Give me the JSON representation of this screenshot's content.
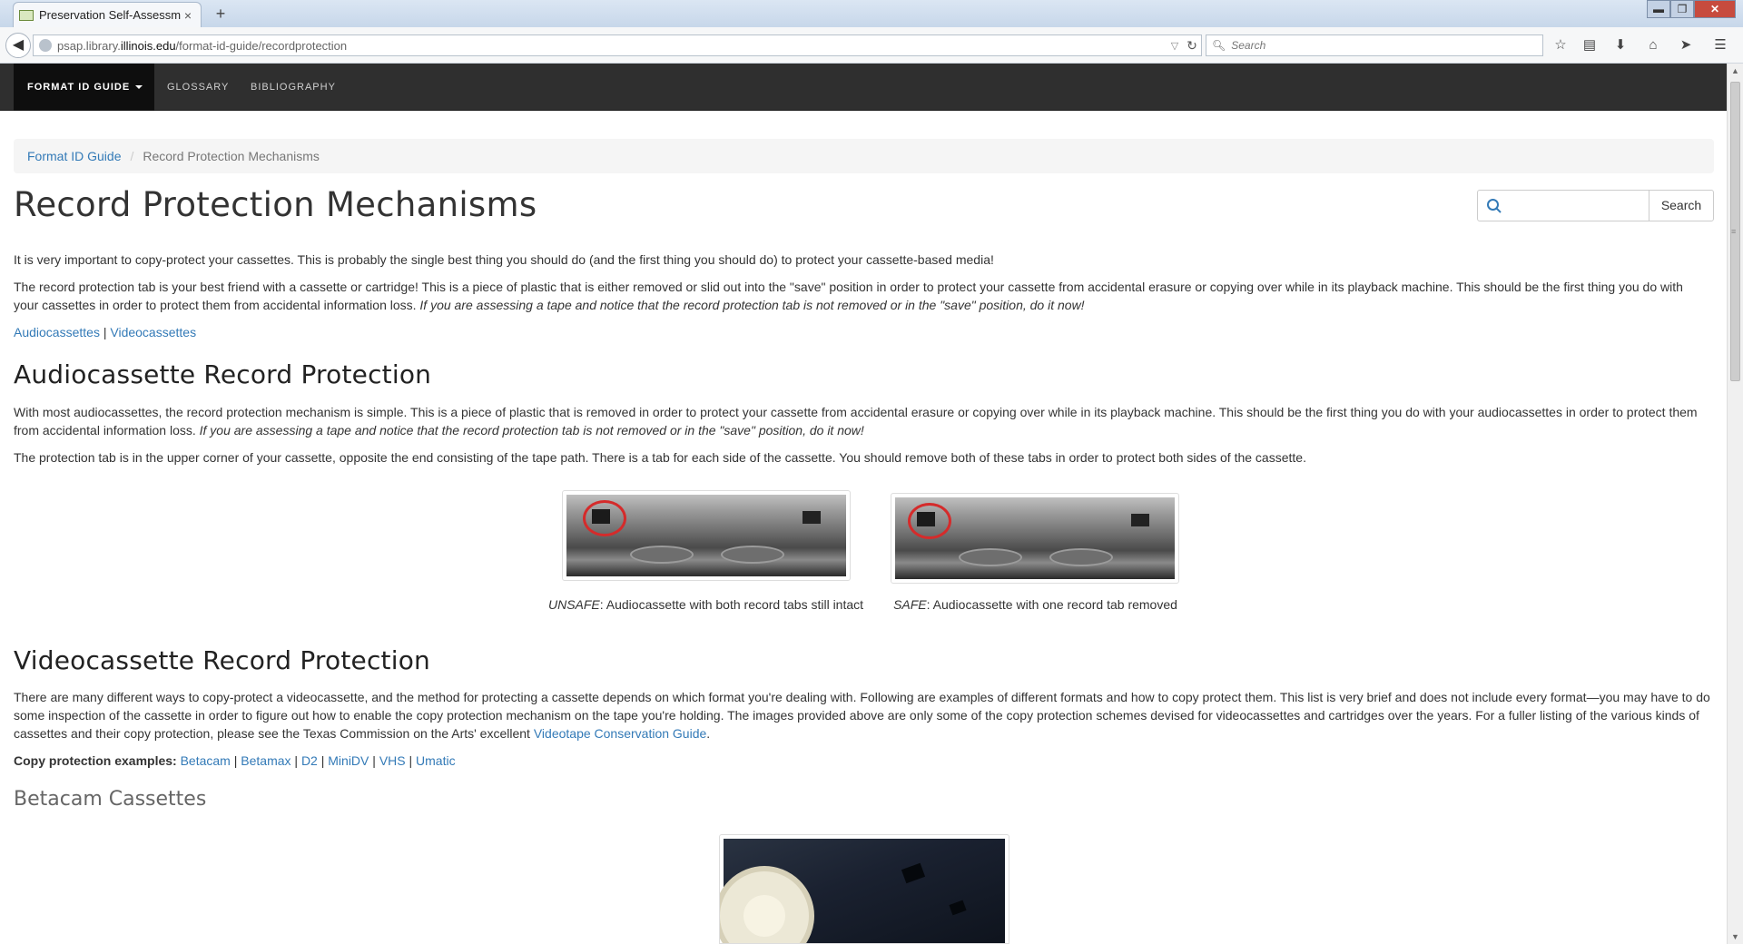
{
  "browser": {
    "tab_title": "Preservation Self-Assessme...",
    "tab_close": "×",
    "new_tab": "+",
    "url_domain_prefix": "psap.library.",
    "url_domain": "illinois.edu",
    "url_path": "/format-id-guide/recordprotection",
    "search_placeholder": "Search",
    "window_min": "▬",
    "window_max": "❐",
    "window_close": "✕"
  },
  "site_nav": {
    "items": [
      {
        "label": "FORMAT ID GUIDE"
      },
      {
        "label": "GLOSSARY"
      },
      {
        "label": "BIBLIOGRAPHY"
      }
    ]
  },
  "breadcrumb": {
    "parent": "Format ID Guide",
    "current": "Record Protection Mechanisms"
  },
  "page": {
    "title": "Record Protection Mechanisms",
    "search_button": "Search",
    "intro1": "It is very important to copy-protect your cassettes. This is probably the single best thing you should do (and the first thing you should do) to protect your cassette-based media!",
    "intro2": "The record protection tab is your best friend with a cassette or cartridge! This is a piece of plastic that is either removed or slid out into the \"save\" position in order to protect your cassette from accidental erasure or copying over while in its playback machine. This should be the first thing you do with your cassettes in order to protect them from accidental information loss. ",
    "intro2_em": "If you are assessing a tape and notice that the record protection tab is not removed or in the \"save\" position, do it now!",
    "link_audio": "Audiocassettes",
    "link_sep": " | ",
    "link_video": "Videocassettes"
  },
  "audio": {
    "heading": "Audiocassette Record Protection",
    "p1": "With most audiocassettes, the record protection mechanism is simple. This is a piece of plastic that is removed in order to protect your cassette from accidental erasure or copying over while in its playback machine. This should be the first thing you do with your audiocassettes in order to protect them from accidental information loss. ",
    "p1_em": "If you are assessing a tape and notice that the record protection tab is not removed or in the \"save\" position, do it now!",
    "p2": "The protection tab is in the upper corner of your cassette, opposite the end consisting of the tape path. There is a tab for each side of the cassette. You should remove both of these tabs in order to protect both sides of the cassette.",
    "fig1_em": "UNSAFE",
    "fig1_text": ": Audiocassette with both record tabs still intact",
    "fig2_em": "SAFE",
    "fig2_text": ": Audiocassette with one record tab removed"
  },
  "video": {
    "heading": "Videocassette Record Protection",
    "p1": "There are many different ways to copy-protect a videocassette, and the method for protecting a cassette depends on which format you're dealing with. Following are examples of different formats and how to copy protect them. This list is very brief and does not include every format—you may have to do some inspection of the cassette in order to figure out how to enable the copy protection mechanism on the tape you're holding. The images provided above are only some of the copy protection schemes devised for videocassettes and cartridges over the years. For a fuller listing of the various kinds of cassettes and their copy protection, please see the Texas Commission on the Arts' excellent ",
    "p1_link": "Videotape Conservation Guide",
    "p1_end": ".",
    "examples_label": "Copy protection examples:",
    "examples": [
      "Betacam",
      "Betamax",
      "D2",
      "MiniDV",
      "VHS",
      "Umatic"
    ],
    "betacam_heading": "Betacam Cassettes"
  }
}
